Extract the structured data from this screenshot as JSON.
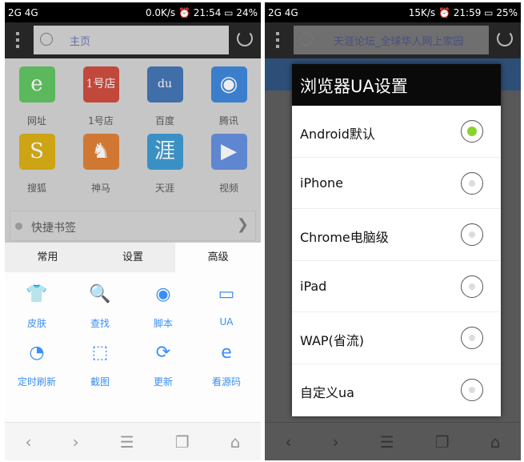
{
  "left": {
    "status": {
      "signal": "2G 4G",
      "speed": "0.0K/s",
      "time": "21:54",
      "battery": "24%"
    },
    "url": "主页",
    "apps": [
      {
        "label": "网址",
        "glyph": "e",
        "color": "#5cb85c"
      },
      {
        "label": "1号店",
        "glyph": "1号店",
        "color": "#c0493c"
      },
      {
        "label": "百度",
        "glyph": "du",
        "color": "#3f6ea8"
      },
      {
        "label": "腾讯",
        "glyph": "◉",
        "color": "#3b7fcc"
      },
      {
        "label": "搜狐",
        "glyph": "S",
        "color": "#cca414"
      },
      {
        "label": "神马",
        "glyph": "♞",
        "color": "#d07833"
      },
      {
        "label": "天涯",
        "glyph": "涯",
        "color": "#3a90c4"
      },
      {
        "label": "视频",
        "glyph": "▶",
        "color": "#5f86d0"
      }
    ],
    "bookmarks": "快捷书签",
    "tabs": [
      "常用",
      "设置",
      "高级"
    ],
    "active_tab": "高级",
    "tools": [
      {
        "label": "皮肤",
        "icon": "shirt-icon",
        "glyph": "👕"
      },
      {
        "label": "查找",
        "icon": "find-icon",
        "glyph": "🔍"
      },
      {
        "label": "脚本",
        "icon": "script-icon",
        "glyph": "◉"
      },
      {
        "label": "UA",
        "icon": "devices-icon",
        "glyph": "▭"
      },
      {
        "label": "定时刷新",
        "icon": "timer-icon",
        "glyph": "◔"
      },
      {
        "label": "截图",
        "icon": "screenshot-icon",
        "glyph": "⬚"
      },
      {
        "label": "更新",
        "icon": "update-icon",
        "glyph": "⟳"
      },
      {
        "label": "看源码",
        "icon": "source-icon",
        "glyph": "e"
      }
    ],
    "accent": "#3a8ff5"
  },
  "right": {
    "status": {
      "signal": "2G 4G",
      "speed": "15K/s",
      "time": "21:59",
      "battery": "25%"
    },
    "url": "天涯论坛_全球华人网上家园",
    "dialog_title": "浏览器UA设置",
    "options": [
      "Android默认",
      "iPhone",
      "Chrome电脑级",
      "iPad",
      "WAP(省流)",
      "自定义ua"
    ],
    "selected": "Android默认",
    "selected_color": "#8ad32a"
  },
  "nav_icons": [
    "back-icon",
    "forward-icon",
    "menu-icon",
    "windows-icon",
    "home-icon"
  ]
}
